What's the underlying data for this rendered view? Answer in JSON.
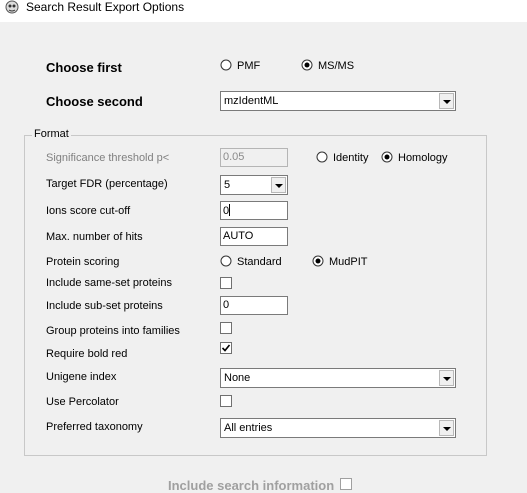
{
  "window": {
    "title": "Search Result Export Options",
    "icon": "mascot-logo-icon"
  },
  "choose_first": {
    "label": "Choose first",
    "options": [
      {
        "label": "PMF",
        "selected": false
      },
      {
        "label": "MS/MS",
        "selected": true
      }
    ]
  },
  "choose_second": {
    "label": "Choose second",
    "value": "mzIdentML"
  },
  "format": {
    "legend": "Format",
    "significance": {
      "label": "Significance threshold p<",
      "value": "0.05",
      "options": [
        {
          "label": "Identity",
          "selected": false
        },
        {
          "label": "Homology",
          "selected": true
        }
      ]
    },
    "target_fdr": {
      "label": "Target FDR (percentage)",
      "value": "5"
    },
    "ions_score": {
      "label": "Ions score cut-off",
      "value": "0"
    },
    "max_hits": {
      "label": "Max. number of hits",
      "value": "AUTO"
    },
    "protein_scoring": {
      "label": "Protein scoring",
      "options": [
        {
          "label": "Standard",
          "selected": false
        },
        {
          "label": "MudPIT",
          "selected": true
        }
      ]
    },
    "same_set": {
      "label": "Include same-set proteins",
      "checked": false
    },
    "sub_set": {
      "label": "Include sub-set proteins",
      "value": "0"
    },
    "group_families": {
      "label": "Group proteins into families",
      "checked": false
    },
    "bold_red": {
      "label": "Require bold red",
      "checked": true
    },
    "unigene": {
      "label": "Unigene index",
      "value": "None"
    },
    "percolator": {
      "label": "Use Percolator",
      "checked": false
    },
    "taxonomy": {
      "label": "Preferred taxonomy",
      "value": "All entries"
    }
  },
  "search_info": {
    "label": "Include search information",
    "checked": false
  },
  "colors": {
    "background": "#f0f0f0",
    "titlebar": "#ffffff",
    "disabled_text": "#808080"
  }
}
